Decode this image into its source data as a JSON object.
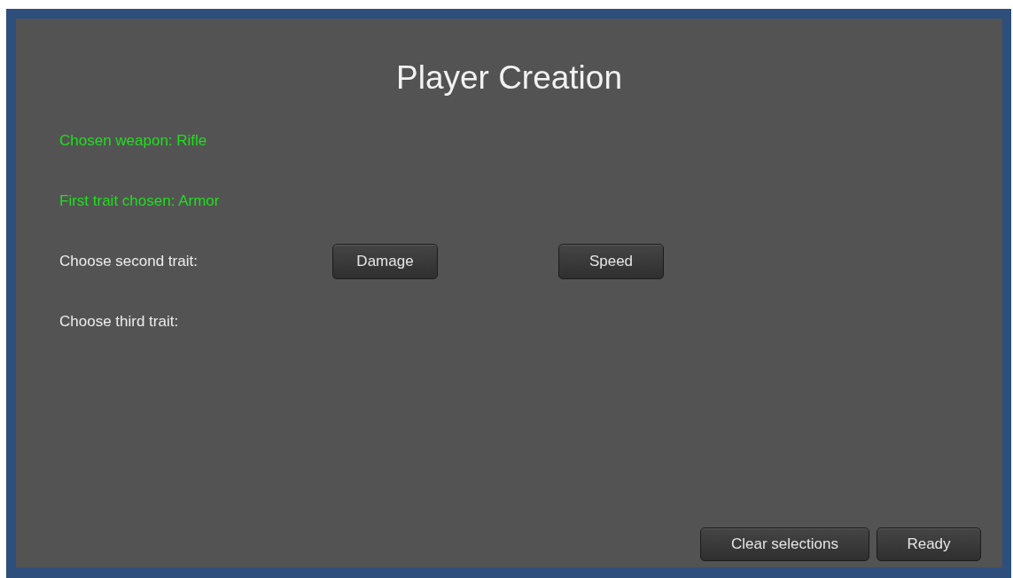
{
  "title": "Player Creation",
  "lines": [
    {
      "kind": "status",
      "text": "Chosen weapon: Rifle"
    },
    {
      "kind": "status",
      "text": "First trait chosen: Armor"
    },
    {
      "kind": "choice",
      "text": "Choose second trait:",
      "options": [
        "Damage",
        "Speed"
      ]
    },
    {
      "kind": "choice",
      "text": "Choose third trait:"
    }
  ],
  "buttons": [
    "Clear selections",
    "Ready"
  ]
}
